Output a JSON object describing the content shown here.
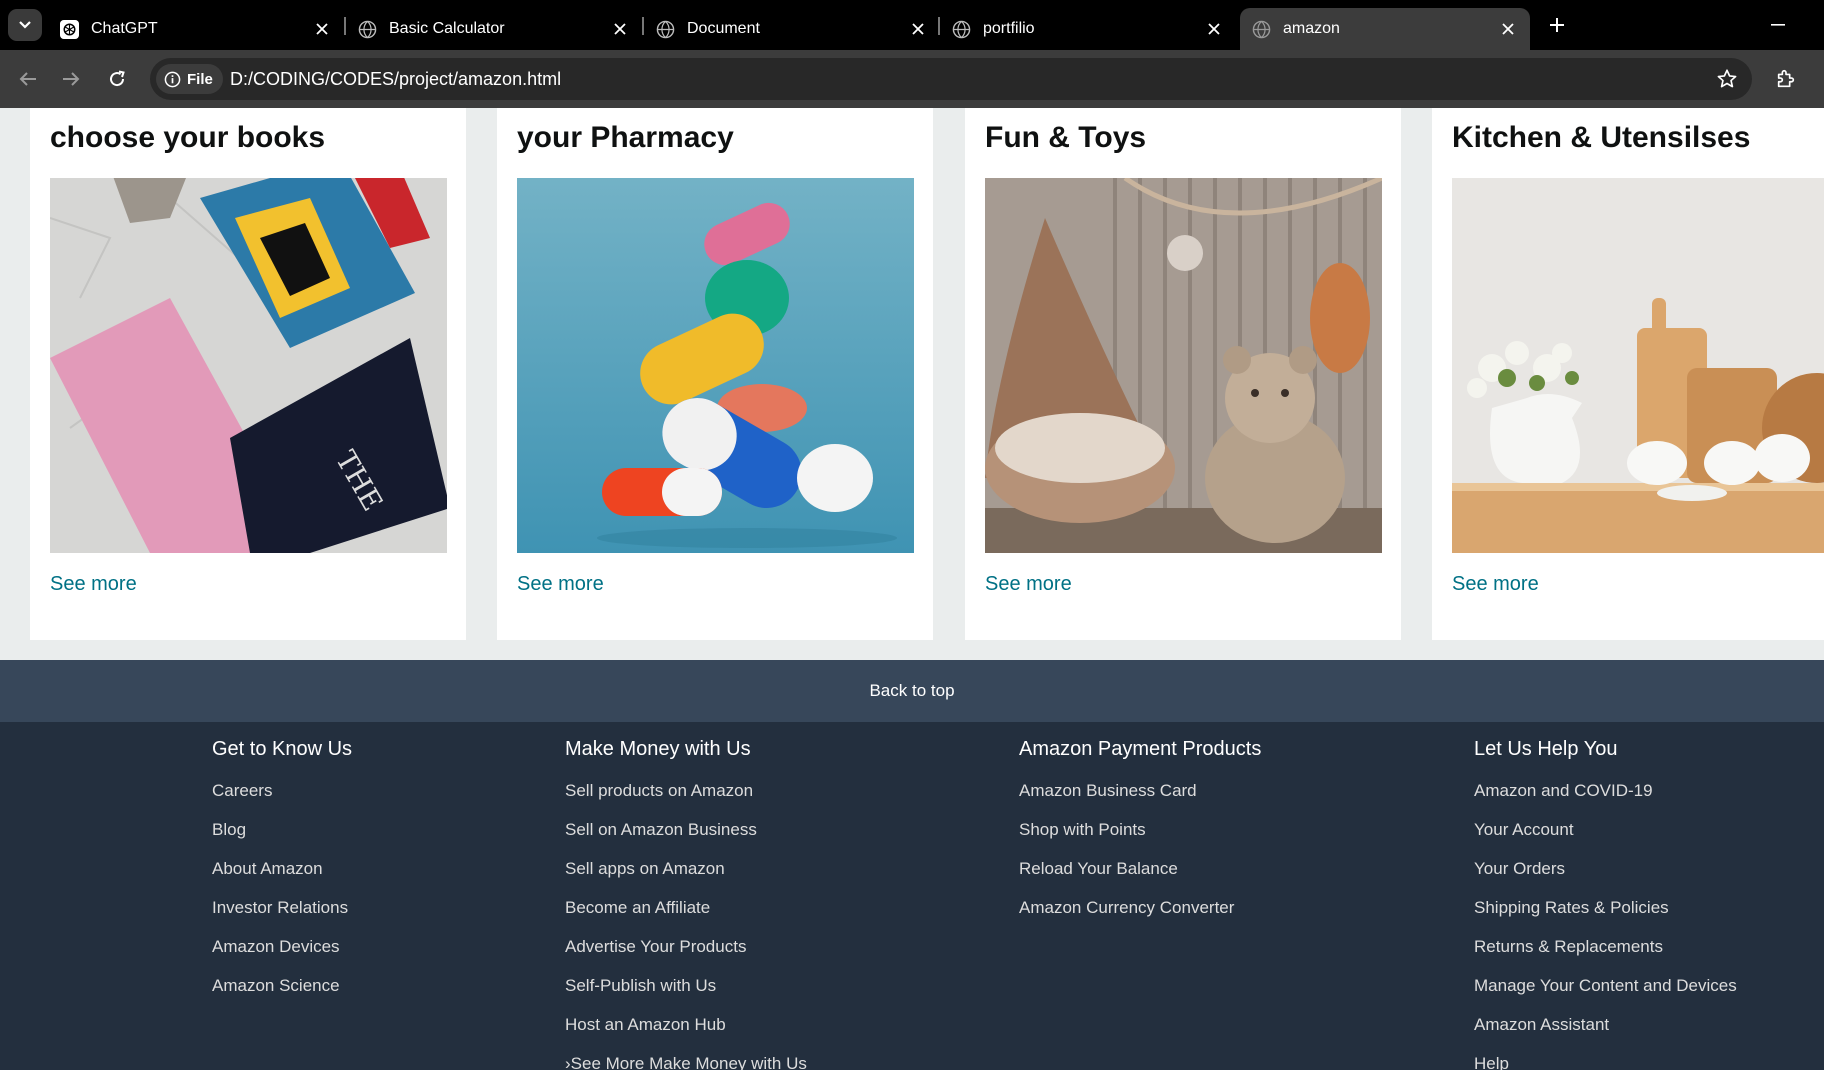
{
  "browser": {
    "tabs": [
      {
        "title": "ChatGPT",
        "icon": "chatgpt-icon"
      },
      {
        "title": "Basic Calculator",
        "icon": "globe-icon"
      },
      {
        "title": "Document",
        "icon": "globe-icon"
      },
      {
        "title": "portfilio",
        "icon": "globe-icon"
      },
      {
        "title": "amazon",
        "icon": "globe-icon",
        "active": true
      }
    ],
    "security_chip": "File",
    "url": "D:/CODING/CODES/project/amazon.html"
  },
  "cards": [
    {
      "title": "choose your books",
      "link": "See more",
      "image": "books-photo"
    },
    {
      "title": "your Pharmacy",
      "link": "See more",
      "image": "pills-photo"
    },
    {
      "title": "Fun & Toys",
      "link": "See more",
      "image": "toys-photo"
    },
    {
      "title": "Kitchen & Utensilses",
      "link": "See more",
      "image": "kitchen-photo"
    }
  ],
  "back_to_top": "Back to top",
  "footer": {
    "columns": [
      {
        "heading": "Get to Know Us",
        "links": [
          "Careers",
          "Blog",
          "About Amazon",
          "Investor Relations",
          "Amazon Devices",
          "Amazon Science"
        ]
      },
      {
        "heading": "Make Money with Us",
        "links": [
          "Sell products on Amazon",
          "Sell on Amazon Business",
          "Sell apps on Amazon",
          "Become an Affiliate",
          "Advertise Your Products",
          "Self-Publish with Us",
          "Host an Amazon Hub",
          "›See More Make Money with Us"
        ]
      },
      {
        "heading": "Amazon Payment Products",
        "links": [
          "Amazon Business Card",
          "Shop with Points",
          "Reload Your Balance",
          "Amazon Currency Converter"
        ]
      },
      {
        "heading": "Let Us Help You",
        "links": [
          "Amazon and COVID-19",
          "Your Account",
          "Your Orders",
          "Shipping Rates & Policies",
          "Returns & Replacements",
          "Manage Your Content and Devices",
          "Amazon Assistant",
          "Help"
        ]
      }
    ]
  },
  "colors": {
    "link": "#007185",
    "back_to_top_bg": "#37475a",
    "footer_bg": "#232f3e",
    "page_bg": "#eaeded"
  }
}
